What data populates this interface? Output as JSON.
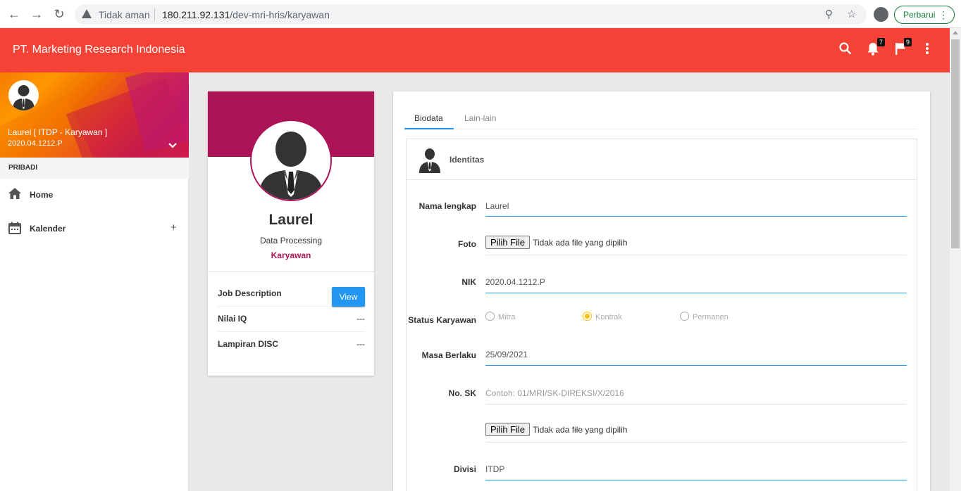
{
  "browser": {
    "security_label": "Tidak aman",
    "url_host": "180.211.92.131",
    "url_path": "/dev-mri-hris/karyawan",
    "update_label": "Perbarui"
  },
  "appbar": {
    "title": "PT. Marketing Research Indonesia",
    "notifications_count": "7",
    "flags_count": "9"
  },
  "sidebar": {
    "user_name": "Laurel [ ITDP - Karyawan ]",
    "user_nik": "2020.04.1212.P",
    "section": "PRIBADI",
    "items": [
      {
        "label": "Home",
        "icon": "home-icon"
      },
      {
        "label": "Kalender",
        "icon": "calendar-icon"
      }
    ]
  },
  "profile": {
    "name": "Laurel",
    "department": "Data Processing",
    "role": "Karyawan",
    "rows": [
      {
        "label": "Job Description",
        "value": ""
      },
      {
        "label": "Nilai IQ",
        "value": "---"
      },
      {
        "label": "Lampiran DISC",
        "value": "---"
      }
    ],
    "view_label": "View"
  },
  "main": {
    "tabs": [
      "Biodata",
      "Lain-lain"
    ],
    "section_title": "Identitas",
    "fields": {
      "nama_label": "Nama lengkap",
      "nama_value": "Laurel",
      "foto_label": "Foto",
      "file_button": "Pilih File",
      "file_text": "Tidak ada file yang dipilih",
      "nik_label": "NIK",
      "nik_value": "2020.04.1212.P",
      "status_label": "Status Karyawan",
      "status_options": [
        "Mitra",
        "Kontrak",
        "Permanen"
      ],
      "status_selected": "Kontrak",
      "masa_label": "Masa Berlaku",
      "masa_value": "25/09/2021",
      "sk_label": "No. SK",
      "sk_placeholder": "Contoh: 01/MRI/SK-DIREKSI/X/2016",
      "divisi_label": "Divisi",
      "divisi_value": "ITDP"
    }
  },
  "colors": {
    "appbar": "#f44336",
    "profile_header": "#ad1457",
    "accent": "#2196f3",
    "radio_checked": "#ffc107"
  }
}
